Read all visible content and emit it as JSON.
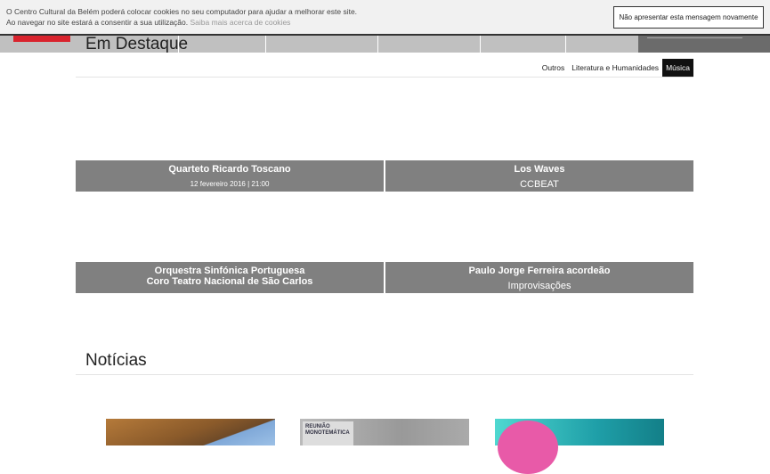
{
  "cookie": {
    "line1": "O Centro Cultural da Belém poderá colocar cookies no seu computador para ajudar a melhorar este site.",
    "line2": "Ao navegar no site estará a consentir a sua utilização.",
    "link": "Saiba mais acerca de cookies",
    "button": "Não apresentar esta mensagem novamente"
  },
  "featured": {
    "title": "Em Destaque",
    "tabs": [
      "Outros",
      "Literatura e Humanidades",
      "Música"
    ],
    "cards": [
      {
        "title": "Quarteto Ricardo Toscano",
        "subtitle": "12 fevereiro 2016 | 21:00"
      },
      {
        "title": "Los Waves",
        "subtitle": "CCBEAT"
      },
      {
        "title": "Orquestra Sinfónica Portuguesa",
        "title2": "Coro Teatro Nacional de São Carlos"
      },
      {
        "title": "Paulo Jorge Ferreira acordeão",
        "subtitle": "Improvisações"
      }
    ]
  },
  "news": {
    "title": "Notícias",
    "image2_text": "REUNIÃO MONOTEMÁTICA"
  }
}
